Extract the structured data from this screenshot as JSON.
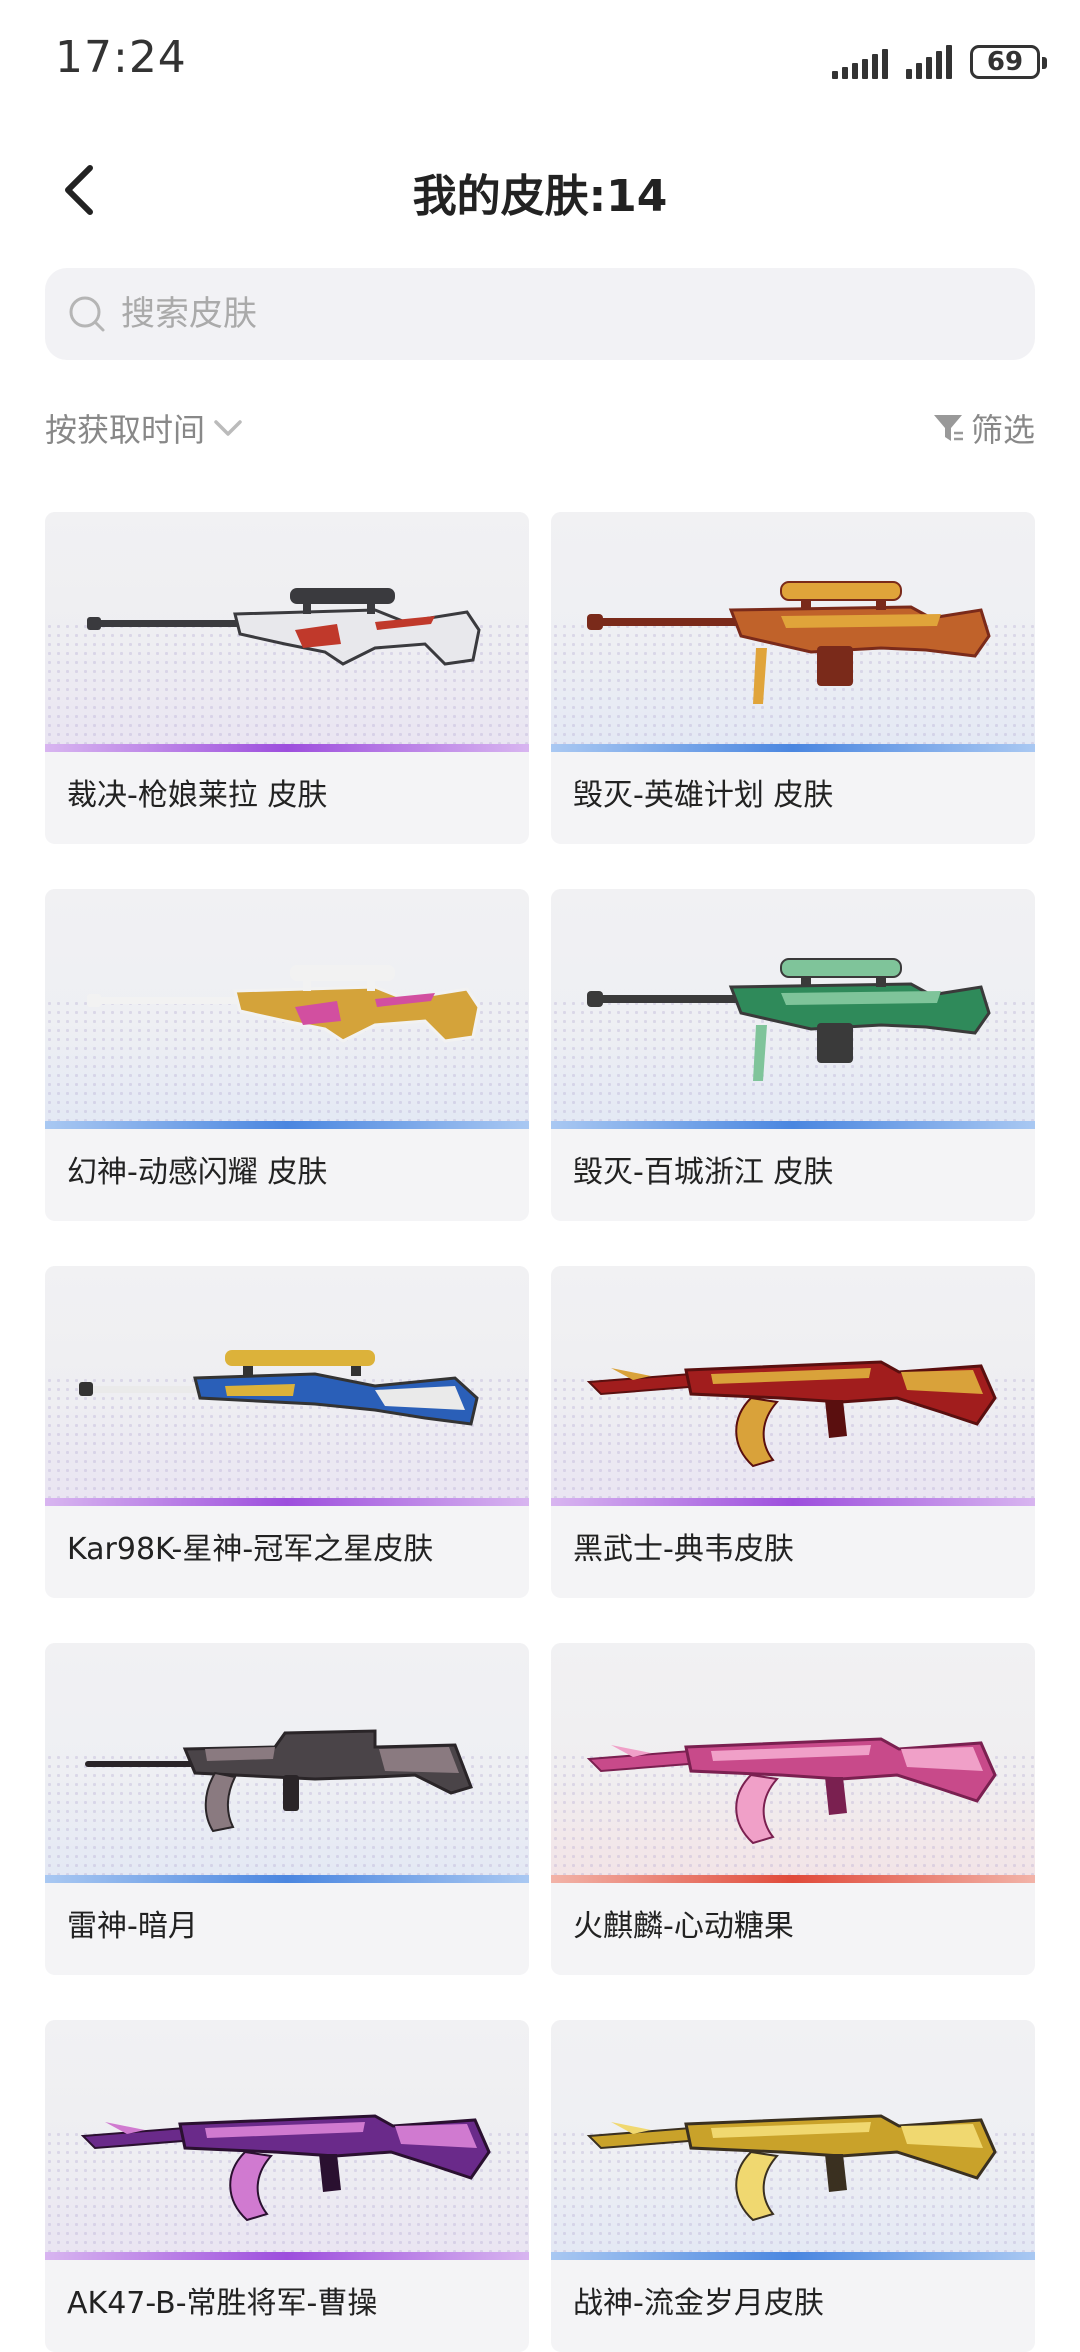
{
  "status_bar": {
    "time": "17:24",
    "battery": "69"
  },
  "header": {
    "title": "我的皮肤:14"
  },
  "search": {
    "placeholder": "搜索皮肤",
    "value": ""
  },
  "sort": {
    "label": "按获取时间"
  },
  "filter": {
    "label": "筛选"
  },
  "colors": {
    "purple": "#9d4edd",
    "blue": "#4a86e0",
    "red": "#e04a3a"
  },
  "skins": [
    {
      "name": "裁决-枪娘莱拉 皮肤",
      "rarity": "purple",
      "weapon": "sniper",
      "colors": [
        "#3a3a3e",
        "#e8e8ec",
        "#c0392b"
      ]
    },
    {
      "name": "毁灭-英雄计划 皮肤",
      "rarity": "blue",
      "weapon": "heavy-sniper",
      "colors": [
        "#c0622a",
        "#e0a43a",
        "#7a2a1a"
      ]
    },
    {
      "name": "幻神-动感闪耀 皮肤",
      "rarity": "blue",
      "weapon": "sniper",
      "colors": [
        "#f2f2f2",
        "#d4a33a",
        "#d24fa0"
      ]
    },
    {
      "name": "毁灭-百城浙江 皮肤",
      "rarity": "blue",
      "weapon": "heavy-sniper",
      "colors": [
        "#2f8a5a",
        "#7fc49a",
        "#3a3a3a"
      ]
    },
    {
      "name": "Kar98K-星神-冠军之星皮肤",
      "rarity": "purple",
      "weapon": "bolt",
      "colors": [
        "#2a5fb8",
        "#dcb23a",
        "#eaeaea"
      ]
    },
    {
      "name": "黑武士-典韦皮肤",
      "rarity": "purple",
      "weapon": "rifle",
      "colors": [
        "#a11d1d",
        "#d9a23a",
        "#5a0f0f"
      ]
    },
    {
      "name": "雷神-暗月",
      "rarity": "blue",
      "weapon": "m4",
      "colors": [
        "#4a4448",
        "#8a7a80",
        "#2a2528"
      ]
    },
    {
      "name": "火麒麟-心动糖果",
      "rarity": "red",
      "weapon": "rifle",
      "colors": [
        "#c84a8a",
        "#f0a0c8",
        "#7a2050"
      ]
    },
    {
      "name": "AK47-B-常胜将军-曹操",
      "rarity": "purple",
      "weapon": "rifle",
      "colors": [
        "#6a2a8a",
        "#d07ad0",
        "#2a1030"
      ]
    },
    {
      "name": "战神-流金岁月皮肤",
      "rarity": "blue",
      "weapon": "rifle",
      "colors": [
        "#c9a22a",
        "#f0d870",
        "#3a3020"
      ]
    }
  ]
}
